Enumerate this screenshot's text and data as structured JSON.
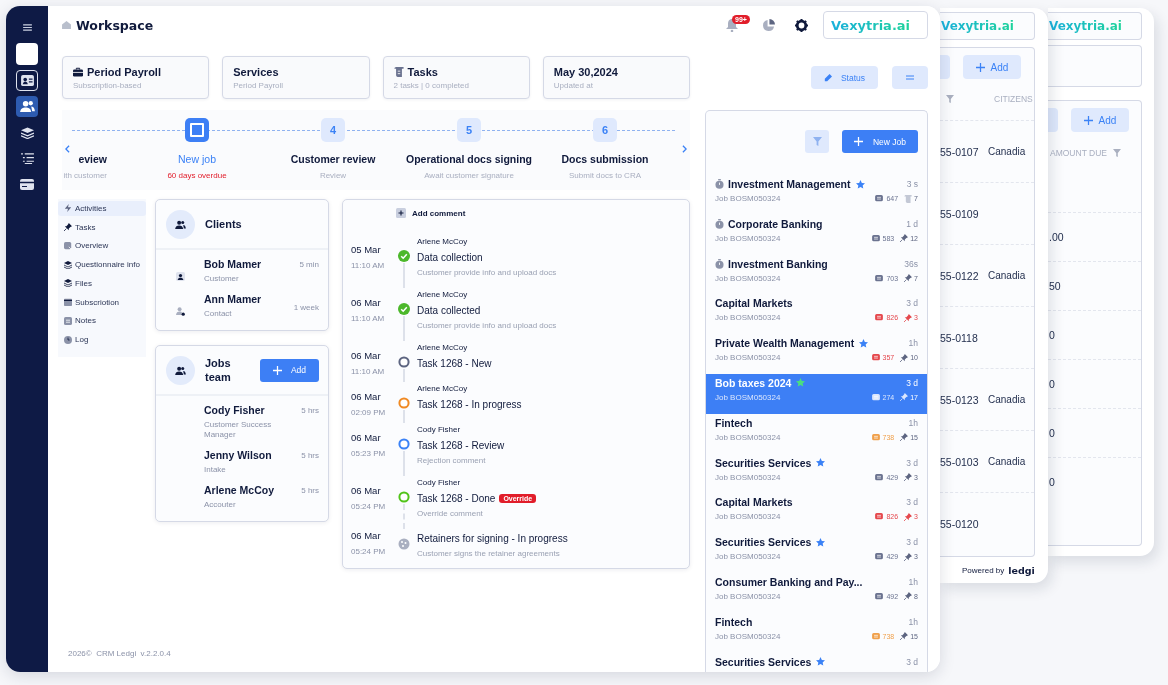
{
  "sidebar": {
    "items": [
      {
        "kind": "menu",
        "selected": false
      },
      {
        "kind": "blank",
        "selected": false
      },
      {
        "kind": "contact",
        "selected": false
      },
      {
        "kind": "people",
        "selected": true
      },
      {
        "kind": "layers",
        "selected": false
      },
      {
        "kind": "list",
        "selected": false
      },
      {
        "kind": "card",
        "selected": false
      }
    ]
  },
  "header": {
    "title": "Workspace",
    "notifications": "99+",
    "logo": "Vexytria.ai"
  },
  "summary_cards": [
    {
      "title": "Period Payroll",
      "subtitle": "Subscription-based"
    },
    {
      "title": "Services",
      "subtitle": "Period Payroll"
    },
    {
      "title": "Tasks",
      "subtitle": "2 tasks | 0 completed"
    },
    {
      "title": "May 30,2024",
      "subtitle": "Updated at"
    }
  ],
  "status_button": "Status",
  "stepper": {
    "steps": [
      {
        "label": "eview",
        "sublabel": "ith customer",
        "kind": "cut"
      },
      {
        "label": "New job",
        "sublabel": "60 days overdue",
        "kind": "current"
      },
      {
        "number": "4",
        "label": "Customer review",
        "sublabel": "Review",
        "kind": "upcoming"
      },
      {
        "number": "5",
        "label": "Operational docs signing",
        "sublabel": "Await customer signature",
        "kind": "upcoming"
      },
      {
        "number": "6",
        "label": "Docs submission",
        "sublabel": "Submit docs to CRA",
        "kind": "upcoming"
      }
    ]
  },
  "nav": [
    {
      "label": "Activities",
      "selected": true
    },
    {
      "label": "Tasks",
      "selected": false
    },
    {
      "label": "Overview",
      "selected": false
    },
    {
      "label": "Questionnaire info",
      "selected": false
    },
    {
      "label": "Files",
      "selected": false
    },
    {
      "label": "Subscriotion",
      "selected": false
    },
    {
      "label": "Notes",
      "selected": false
    },
    {
      "label": "Log",
      "selected": false
    }
  ],
  "clients": {
    "title": "Clients",
    "people": [
      {
        "name": "Bob Mamer",
        "role": "Customer",
        "time": "5 min"
      },
      {
        "name": "Ann Mamer",
        "role": "Contact",
        "time": "1 week"
      }
    ]
  },
  "team": {
    "title": "Jobs team",
    "add_button": "Add",
    "people": [
      {
        "name": "Cody Fisher",
        "role": "Customer Success Manager",
        "time": "5 hrs"
      },
      {
        "name": "Jenny Wilson",
        "role": "Intake",
        "time": "5 hrs"
      },
      {
        "name": "Arlene McCoy",
        "role": "Accouter",
        "time": "5 hrs"
      }
    ]
  },
  "timeline": {
    "add_comment": "Add comment",
    "entries": [
      {
        "date": "05 Mar",
        "time": "11:10 AM",
        "author": "Arlene McCoy",
        "title": "Data collection",
        "note": "Customer provide info and upload docs",
        "kind": "done"
      },
      {
        "date": "06 Mar",
        "time": "11:10 AM",
        "author": "Arlene McCoy",
        "title": "Data collected",
        "note": "Customer provide info and upload docs",
        "kind": "done"
      },
      {
        "date": "06 Mar",
        "time": "11:10 AM",
        "author": "Arlene McCoy",
        "title": "Task 1268 - New",
        "kind": "new"
      },
      {
        "date": "06 Mar",
        "time": "02:09 PM",
        "author": "Arlene McCoy",
        "title": "Task 1268 - In progress",
        "kind": "progress"
      },
      {
        "date": "06 Mar",
        "time": "05:23 PM",
        "author": "Cody Fisher",
        "title": "Task 1268 - Review",
        "note": "Rejection comment",
        "kind": "review"
      },
      {
        "date": "06 Mar",
        "time": "05:24 PM",
        "author": "Cody Fisher",
        "title": "Task 1268 - Done",
        "badge": "Override",
        "note": "Override comment",
        "kind": "finished"
      },
      {
        "date": "06 Mar",
        "time": "05:24 PM",
        "title": "Retainers for signing - In progress",
        "note": "Customer signs the retainer agreements",
        "kind": "pending"
      }
    ]
  },
  "jobs": {
    "new_job_button": "New Job",
    "items": [
      {
        "title": "Investment Management",
        "timer": true,
        "color": "#3b82f6",
        "time": "3 s",
        "id": "Job BOSM050324",
        "comments": "647",
        "comments_alert": false,
        "comments_warning": false,
        "kind": "scroll",
        "count": "7",
        "count_alert": false,
        "selected": false
      },
      {
        "title": "Corporate Banking",
        "timer": true,
        "time": "1 d",
        "id": "Job BOSM050324",
        "comments": "583",
        "comments_alert": false,
        "comments_warning": false,
        "kind": "pin",
        "count": "12",
        "count_alert": false,
        "selected": false
      },
      {
        "title": "Investment Banking",
        "timer": true,
        "time": "36s",
        "id": "Job BOSM050324",
        "comments": "703",
        "comments_alert": false,
        "comments_warning": false,
        "kind": "pin",
        "count": "7",
        "count_alert": false,
        "selected": false
      },
      {
        "title": "Capital Markets",
        "timer": false,
        "time": "3 d",
        "id": "Job BOSM050324",
        "comments": "826",
        "comments_alert": true,
        "comments_warning": false,
        "kind": "pin",
        "count": "3",
        "count_alert": true,
        "selected": false
      },
      {
        "title": "Private Wealth Management",
        "timer": false,
        "color": "#3b82f6",
        "time": "1h",
        "id": "Job BOSM050324",
        "comments": "357",
        "comments_alert": true,
        "comments_warning": false,
        "kind": "pin",
        "count": "10",
        "count_alert": false,
        "selected": false
      },
      {
        "title": "Bob taxes 2024",
        "timer": false,
        "color": "#4ade80",
        "time": "3 d",
        "id": "Job BOSM050324",
        "comments": "274",
        "comments_alert": false,
        "comments_warning": false,
        "kind": "pin",
        "count": "17",
        "count_alert": false,
        "selected": true
      },
      {
        "title": "Fintech",
        "timer": false,
        "time": "1h",
        "id": "Job BOSM050324",
        "comments": "738",
        "comments_alert": false,
        "comments_warning": true,
        "kind": "pin",
        "count": "15",
        "count_alert": false,
        "selected": false
      },
      {
        "title": "Securities Services",
        "timer": false,
        "color": "#3b82f6",
        "time": "3 d",
        "id": "Job BOSM050324",
        "comments": "429",
        "comments_alert": false,
        "comments_warning": false,
        "kind": "pin",
        "count": "3",
        "count_alert": false,
        "selected": false
      },
      {
        "title": "Capital Markets",
        "timer": false,
        "time": "3 d",
        "id": "Job BOSM050324",
        "comments": "826",
        "comments_alert": true,
        "comments_warning": false,
        "kind": "pin",
        "count": "3",
        "count_alert": true,
        "selected": false
      },
      {
        "title": "Securities Services",
        "timer": false,
        "color": "#3b82f6",
        "time": "3 d",
        "id": "Job BOSM050324",
        "comments": "429",
        "comments_alert": false,
        "comments_warning": false,
        "kind": "pin",
        "count": "3",
        "count_alert": false,
        "selected": false
      },
      {
        "title": "Consumer Banking and Pay...",
        "timer": false,
        "time": "1h",
        "id": "Job BOSM050324",
        "comments": "492",
        "comments_alert": false,
        "comments_warning": false,
        "kind": "pin",
        "count": "8",
        "count_alert": false,
        "selected": false
      },
      {
        "title": "Fintech",
        "timer": false,
        "time": "1h",
        "id": "Job BOSM050324",
        "comments": "738",
        "comments_alert": false,
        "comments_warning": true,
        "kind": "pin",
        "count": "15",
        "count_alert": false,
        "selected": false
      },
      {
        "title": "Securities Services",
        "timer": false,
        "color": "#3b82f6",
        "time": "3 d",
        "selected": false
      }
    ]
  },
  "footer": "2026©  CRM Ledgi  v.2.2.0.4",
  "back_windows": [
    {
      "logo": "Vexytria.ai",
      "add_button": "Add",
      "column": "CITIZENS",
      "rows": [
        {
          "phone": "55-0107",
          "citizenship": "Canadia"
        },
        {
          "phone": "55-0109"
        },
        {
          "phone": "55-0122",
          "citizenship": "Canadia"
        },
        {
          "phone": "55-0118"
        },
        {
          "phone": "55-0123",
          "citizenship": "Canadia"
        },
        {
          "phone": "55-0103",
          "citizenship": "Canadia"
        },
        {
          "phone": "55-0120"
        }
      ],
      "powered_by": "Powered by",
      "brand": "ledgi"
    },
    {
      "logo": "Vexytria.ai",
      "add_button": "Add",
      "column": "AMOUNT DUE",
      "rows": [
        {
          "amount": ".00"
        },
        {
          "amount": "50"
        },
        {
          "amount": "0"
        },
        {
          "amount": "0"
        },
        {
          "amount": "0"
        },
        {
          "amount": "0"
        }
      ]
    }
  ]
}
